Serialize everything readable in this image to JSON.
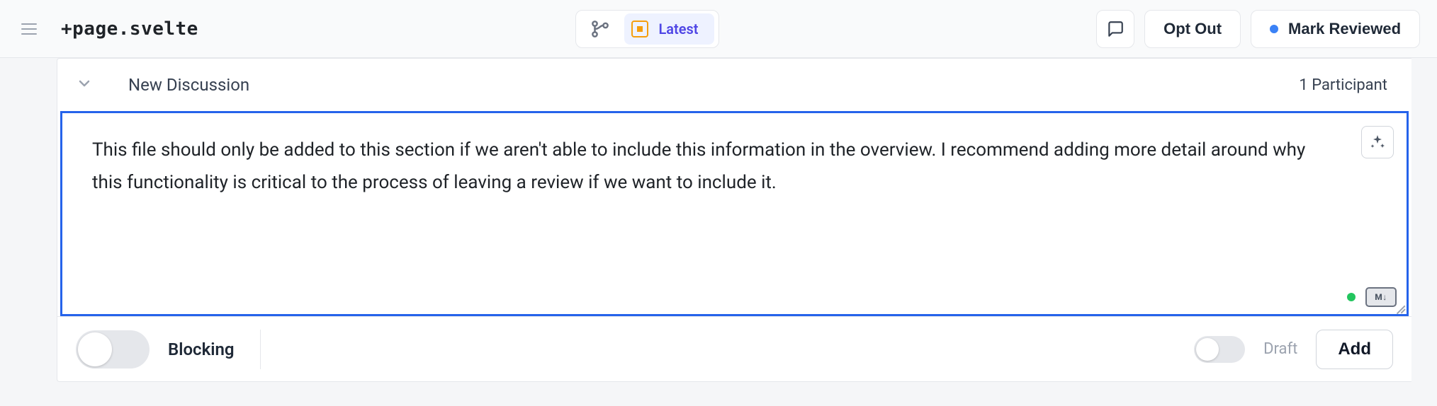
{
  "header": {
    "filename": "+page.svelte",
    "branch_label": "Latest",
    "opt_out_label": "Opt Out",
    "mark_reviewed_label": "Mark Reviewed"
  },
  "discussion": {
    "title": "New Discussion",
    "participants_label": "1 Participant",
    "comment_text": "This file should only be added to this section if we aren't able to include this information in the overview. I recommend adding more detail around why this functionality is critical to the process of leaving a review if we want to include it.",
    "markdown_badge": "M↓"
  },
  "footer": {
    "blocking_label": "Blocking",
    "draft_label": "Draft",
    "add_label": "Add"
  }
}
